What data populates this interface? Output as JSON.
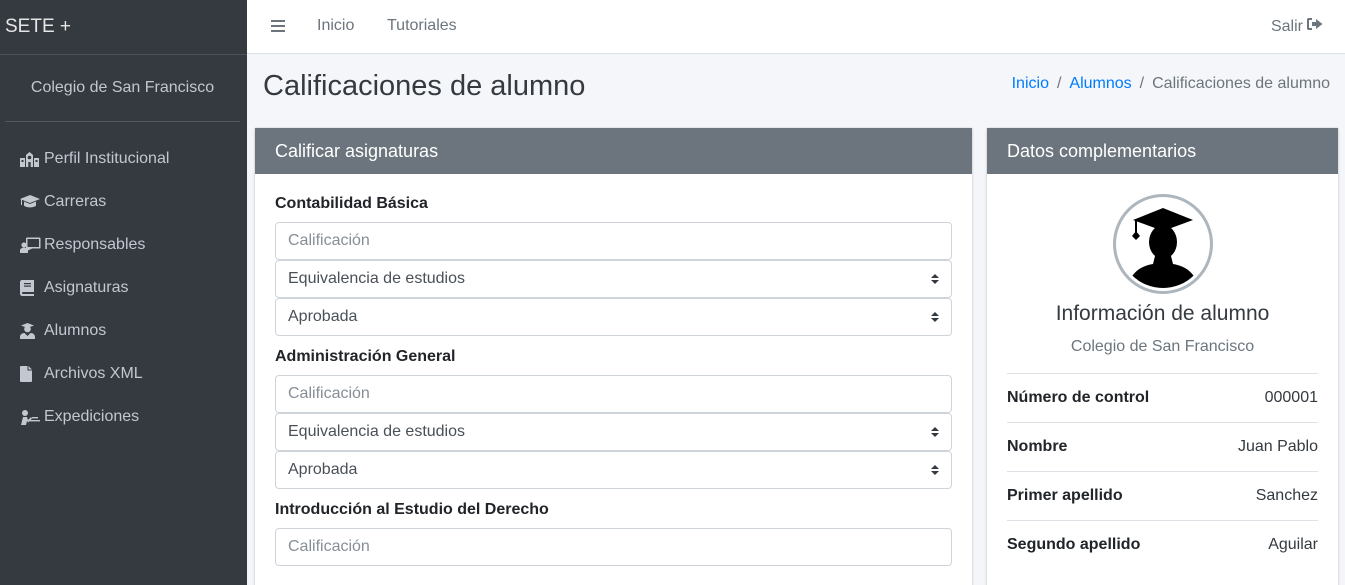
{
  "brand": "SETE +",
  "sidebar": {
    "school": "Colegio de San Francisco",
    "items": [
      {
        "label": "Perfil Institucional",
        "icon": "school-icon"
      },
      {
        "label": "Carreras",
        "icon": "graduation-cap-icon"
      },
      {
        "label": "Responsables",
        "icon": "chalkboard-teacher-icon"
      },
      {
        "label": "Asignaturas",
        "icon": "book-icon"
      },
      {
        "label": "Alumnos",
        "icon": "user-graduate-icon"
      },
      {
        "label": "Archivos XML",
        "icon": "file-icon"
      },
      {
        "label": "Expediciones",
        "icon": "diploma-icon"
      }
    ]
  },
  "topbar": {
    "menu_icon": "bars-icon",
    "links": [
      "Inicio",
      "Tutoriales"
    ],
    "logout": "Salir",
    "logout_icon": "sign-out-icon"
  },
  "page": {
    "title": "Calificaciones de alumno",
    "breadcrumb": [
      "Inicio",
      "Alumnos",
      "Calificaciones de alumno"
    ],
    "breadcrumb_separator": "/"
  },
  "grades_card": {
    "header": "Calificar asignaturas",
    "subjects": [
      {
        "name": "Contabilidad Básica",
        "grade_placeholder": "Calificación",
        "type_value": "Equivalencia de estudios",
        "status_value": "Aprobada"
      },
      {
        "name": "Administración General",
        "grade_placeholder": "Calificación",
        "type_value": "Equivalencia de estudios",
        "status_value": "Aprobada"
      },
      {
        "name": "Introducción al Estudio del Derecho",
        "grade_placeholder": "Calificación"
      }
    ]
  },
  "info_card": {
    "header": "Datos complementarios",
    "title": "Información de alumno",
    "subtitle": "Colegio de San Francisco",
    "rows": [
      {
        "label": "Número de control",
        "value": "000001"
      },
      {
        "label": "Nombre",
        "value": "Juan Pablo"
      },
      {
        "label": "Primer apellido",
        "value": "Sanchez"
      },
      {
        "label": "Segundo apellido",
        "value": "Aguilar"
      }
    ]
  },
  "colors": {
    "sidebar_bg": "#343a40",
    "card_header_bg": "#6c757d",
    "link": "#007bff",
    "page_bg": "#f4f6f9"
  }
}
